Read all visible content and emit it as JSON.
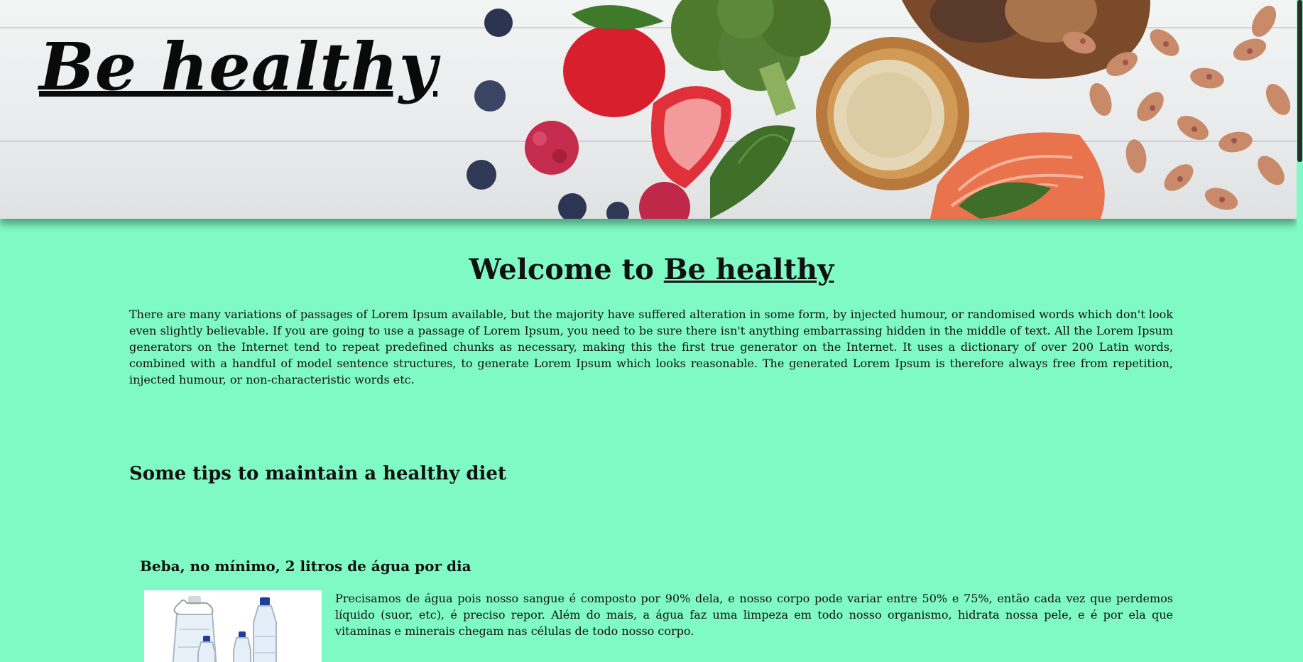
{
  "header": {
    "logo_text": "Be healthy"
  },
  "welcome": {
    "prefix": "Welcome to ",
    "brand": "Be healthy"
  },
  "intro": {
    "text": "There are many variations of passages of Lorem Ipsum available, but the majority have suffered alteration in some form, by injected humour, or randomised words which don't look even slightly believable. If you are going to use a passage of Lorem Ipsum, you need to be sure there isn't anything embarrassing hidden in the middle of text. All the Lorem Ipsum generators on the Internet tend to repeat predefined chunks as necessary, making this the first true generator on the Internet. It uses a dictionary of over 200 Latin words, combined with a handful of model sentence structures, to generate Lorem Ipsum which looks reasonable. The generated Lorem Ipsum is therefore always free from repetition, injected humour, or non-characteristic words etc."
  },
  "tips": {
    "heading": "Some tips to maintain a healthy diet",
    "items": [
      {
        "title": "Beba, no mínimo, 2 litros de água por dia",
        "text": "Precisamos de água pois nosso sangue é composto por 90% dela, e nosso corpo pode variar entre 50% e 75%, então cada vez que perdemos líquido (suor, etc), é preciso repor. Além do mais, a água faz uma limpeza em todo nosso organismo, hidrata nossa pele, e é por ela que vitaminas e minerais chegam nas células de todo nosso corpo.",
        "image_icon": "water-bottles-image"
      }
    ]
  },
  "colors": {
    "background": "#7ffac4",
    "banner": "#e9ebec",
    "text": "#111111"
  }
}
